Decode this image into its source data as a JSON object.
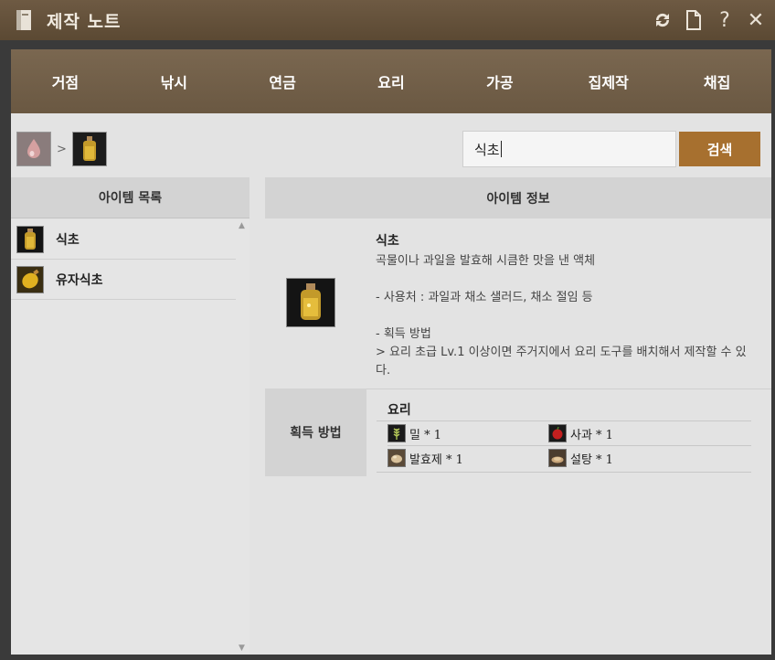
{
  "window": {
    "title": "제작 노트"
  },
  "title_icons": [
    "refresh-icon",
    "document-icon",
    "help-icon",
    "close-icon"
  ],
  "tabs": [
    {
      "label": "거점"
    },
    {
      "label": "낚시"
    },
    {
      "label": "연금"
    },
    {
      "label": "요리"
    },
    {
      "label": "가공"
    },
    {
      "label": "집제작"
    },
    {
      "label": "채집"
    }
  ],
  "breadcrumb": {
    "separator": ">"
  },
  "search": {
    "value": "식초",
    "button_label": "검색"
  },
  "item_list": {
    "header": "아이템 목록",
    "items": [
      {
        "label": "식초"
      },
      {
        "label": "유자식초"
      }
    ]
  },
  "item_info": {
    "header": "아이템 정보",
    "name": "식초",
    "description_lines": [
      "곡물이나 과일을 발효해 시큼한 맛을 낸 액체",
      "",
      "- 사용처 : 과일과 채소 샐러드, 채소 절임 등",
      "",
      "- 획득 방법",
      "> 요리 초급 Lv.1 이상이면 주거지에서 요리 도구를 배치해서 제작할 수 있다."
    ]
  },
  "acquisition": {
    "label": "획득 방법",
    "method": "요리",
    "ingredients": [
      {
        "label": "밀 * 1",
        "icon": "wheat-icon"
      },
      {
        "label": "사과 * 1",
        "icon": "apple-icon"
      },
      {
        "label": "발효제 * 1",
        "icon": "leaven-icon"
      },
      {
        "label": "설탕 * 1",
        "icon": "sugar-icon"
      }
    ]
  },
  "colors": {
    "accent": "#a7702f",
    "tab_bar": "#6f5c46",
    "panel": "#e3e3e3"
  }
}
